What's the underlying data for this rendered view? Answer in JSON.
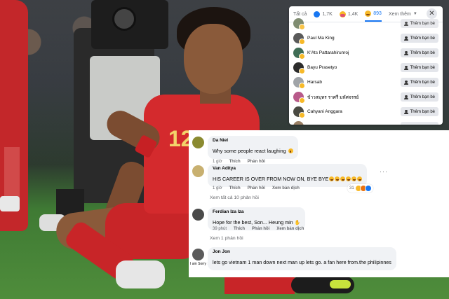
{
  "background": {
    "jersey_number": "12"
  },
  "reactions_dialog": {
    "tabs": [
      {
        "label": "Tất cả"
      },
      {
        "icon": "like-emoji",
        "count": "1,7K"
      },
      {
        "icon": "care-emoji",
        "count": "1,4K"
      },
      {
        "icon": "haha-emoji",
        "count": "893"
      }
    ],
    "more_label": "Xem thêm",
    "close_icon": "close-icon",
    "add_friend_label": "Thêm bạn bè",
    "people": [
      {
        "name": "",
        "avatar_color": "#6b7a5a"
      },
      {
        "name": "Paul Ma King",
        "avatar_color": "#5a5a5a"
      },
      {
        "name": "K'Ats Pattarahirunroj",
        "avatar_color": "#3f6d55"
      },
      {
        "name": "Bayu Prasetyo",
        "avatar_color": "#2c2c2c"
      },
      {
        "name": "Harsab",
        "avatar_color": "#a0a4a8"
      },
      {
        "name": "ข้าวสมุทร ราศรี มหัศจรรย์",
        "avatar_color": "#b85a8a"
      },
      {
        "name": "Cahyani Anggara",
        "avatar_color": "#4a4a42"
      },
      {
        "name": "",
        "avatar_color": "#8a6a4a"
      }
    ]
  },
  "comments": [
    {
      "author": "Da Niel",
      "text": "Why some people react laughing",
      "time": "1 giờ",
      "like_label": "Thích",
      "reply_label": "Phản hồi",
      "avatar_color": "#8a8a30"
    },
    {
      "author": "Van Aditya",
      "text": "HIS CAREER IS OVER FROM NOW ON, BYE BYE",
      "time": "1 giờ",
      "like_label": "Thích",
      "reply_label": "Phản hồi",
      "translate_label": "Xem bản dịch",
      "reaction_count": "31",
      "avatar_color": "#c8b070"
    },
    {
      "author": "Ferdian Iza Iza",
      "text": "Hope for the best, Son... Heung min",
      "time": "39 phút",
      "like_label": "Thích",
      "reply_label": "Phản hồi",
      "translate_label": "Xem bản dịch",
      "avatar_color": "#4a4a4a"
    },
    {
      "author": "Jon Jon",
      "text": "lets go vietnam 1 man down next man up lets go. a fan here from.the philipinnes",
      "time": "",
      "avatar_color": "#5b5b5b",
      "avatar_caption": "I am Sorry !!!!"
    }
  ],
  "view_replies": [
    "Xem tất cả 10 phản hồi",
    "Xem 1 phản hồi"
  ]
}
